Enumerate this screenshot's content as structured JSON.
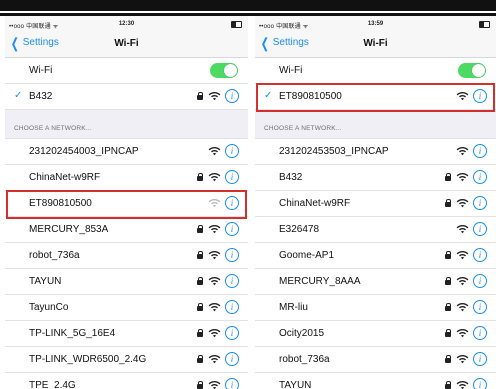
{
  "left": {
    "status": {
      "carrier": "••ooo 中国联通 ᯤ",
      "time": "12:30"
    },
    "nav": {
      "back": "Settings",
      "title": "Wi-Fi"
    },
    "wifi_label": "Wi-Fi",
    "connected": "B432",
    "section": "CHOOSE A NETWORK...",
    "networks": [
      {
        "name": "231202454003_IPNCAP",
        "locked": false
      },
      {
        "name": "ChinaNet-w9RF",
        "locked": true
      },
      {
        "name": "ET890810500",
        "locked": false,
        "faint": true,
        "highlighted": true
      },
      {
        "name": "MERCURY_853A",
        "locked": true
      },
      {
        "name": "robot_736a",
        "locked": true
      },
      {
        "name": "TAYUN",
        "locked": true
      },
      {
        "name": "TayunCo",
        "locked": true
      },
      {
        "name": "TP-LINK_5G_16E4",
        "locked": true
      },
      {
        "name": "TP-LINK_WDR6500_2.4G",
        "locked": true
      },
      {
        "name": "TPE_2.4G",
        "locked": true
      }
    ]
  },
  "right": {
    "status": {
      "carrier": "••ooo 中国联通 ᯤ",
      "time": "13:59"
    },
    "nav": {
      "back": "Settings",
      "title": "Wi-Fi"
    },
    "wifi_label": "Wi-Fi",
    "connected": "ET890810500",
    "section": "CHOOSE A NETWORK...",
    "networks": [
      {
        "name": "231202453503_IPNCAP",
        "locked": false
      },
      {
        "name": "B432",
        "locked": true
      },
      {
        "name": "ChinaNet-w9RF",
        "locked": true
      },
      {
        "name": "E326478",
        "locked": false
      },
      {
        "name": "Goome-AP1",
        "locked": true
      },
      {
        "name": "MERCURY_8AAA",
        "locked": true
      },
      {
        "name": "MR-liu",
        "locked": true
      },
      {
        "name": "Ocity2015",
        "locked": true
      },
      {
        "name": "robot_736a",
        "locked": true
      },
      {
        "name": "TAYUN",
        "locked": true
      }
    ]
  },
  "colors": {
    "accent": "#1a8cff",
    "toggle_on": "#4cd964",
    "highlight": "#d32f2f"
  }
}
